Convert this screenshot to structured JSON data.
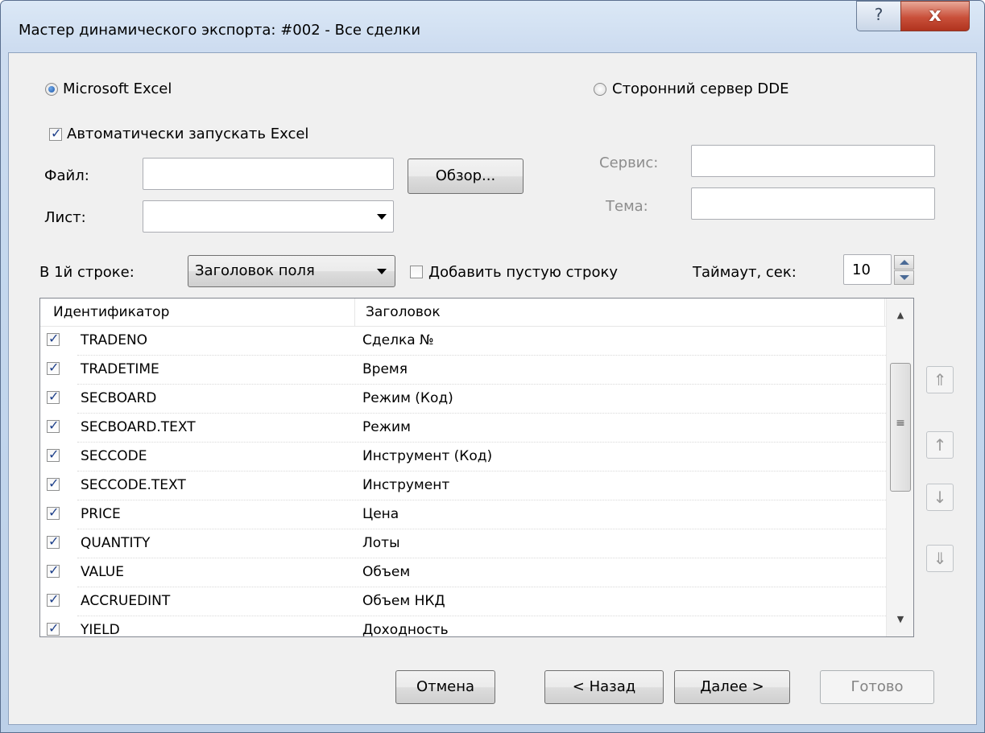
{
  "window": {
    "title": "Мастер динамического экспорта: #002 - Все сделки",
    "help_label": "?",
    "close_label": "x"
  },
  "target": {
    "excel_label": "Microsoft Excel",
    "dde_label": "Сторонний сервер DDE",
    "selected": "Microsoft Excel"
  },
  "excel": {
    "autostart_label": "Автоматически запускать Excel",
    "autostart_checked": true,
    "file_label": "Файл:",
    "file_value": "",
    "browse_label": "Обзор...",
    "sheet_label": "Лист:",
    "sheet_value": ""
  },
  "dde": {
    "service_label": "Сервис:",
    "service_value": "",
    "topic_label": "Тема:",
    "topic_value": ""
  },
  "options": {
    "first_row_label": "В 1й строке:",
    "first_row_value": "Заголовок поля",
    "empty_row_label": "Добавить пустую строку",
    "empty_row_checked": false,
    "timeout_label": "Таймаут, сек:",
    "timeout_value": "10"
  },
  "fields_list": {
    "columns": [
      "Идентификатор",
      "Заголовок"
    ],
    "rows": [
      {
        "id": "TRADENO",
        "header": "Сделка №",
        "checked": true
      },
      {
        "id": "TRADETIME",
        "header": "Время",
        "checked": true
      },
      {
        "id": "SECBOARD",
        "header": "Режим (Код)",
        "checked": true
      },
      {
        "id": "SECBOARD.TEXT",
        "header": "Режим",
        "checked": true
      },
      {
        "id": "SECCODE",
        "header": "Инструмент (Код)",
        "checked": true
      },
      {
        "id": "SECCODE.TEXT",
        "header": "Инструмент",
        "checked": true
      },
      {
        "id": "PRICE",
        "header": "Цена",
        "checked": true
      },
      {
        "id": "QUANTITY",
        "header": "Лоты",
        "checked": true
      },
      {
        "id": "VALUE",
        "header": "Объем",
        "checked": true
      },
      {
        "id": "ACCRUEDINT",
        "header": "Объем НКД",
        "checked": true
      },
      {
        "id": "YIELD",
        "header": "Доходность",
        "checked": true
      }
    ]
  },
  "move_buttons": {
    "top_icon": "move-to-top-icon",
    "up_icon": "move-up-icon",
    "down_icon": "move-down-icon",
    "bottom_icon": "move-to-bottom-icon"
  },
  "footer": {
    "cancel_label": "Отмена",
    "back_label": "< Назад",
    "next_label": "Далее >",
    "finish_label": "Готово"
  }
}
